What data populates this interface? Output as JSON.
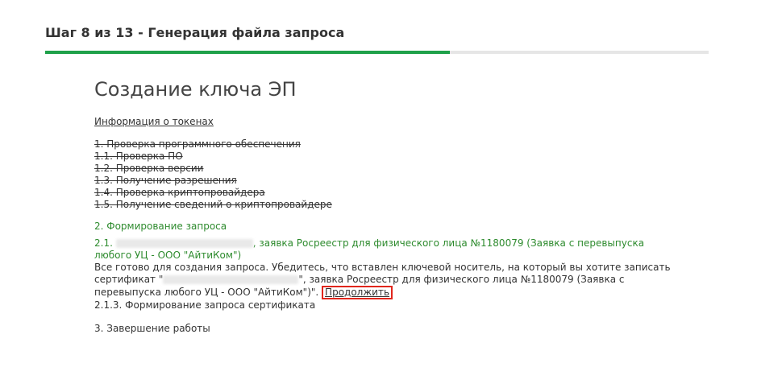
{
  "header": {
    "step_title": "Шаг 8 из 13 - Генерация файла запроса",
    "progress_fraction": 0.61
  },
  "main": {
    "title": "Создание ключа ЭП",
    "token_info_link": "Информация о токенах",
    "section1": {
      "items": [
        "1. Проверка программного обеспечения",
        "1.1. Проверка ПО",
        "1.2. Проверка версии",
        "1.3. Получение разрешения",
        "1.4. Проверка криптопровайдера",
        "1.5. Получение сведений о криптопровайдере"
      ]
    },
    "section2": {
      "title": "2. Формирование запроса",
      "item_number": "2.1.",
      "item_text": ", заявка Росреестр для физического лица №1180079 (Заявка с перевыпуска любого УЦ - ООО \"АйтиКом\")",
      "detail_before": "Все готово для создания запроса. Убедитесь, что вставлен ключевой носитель, на который вы хотите записать сертификат \"",
      "detail_after": "\", заявка Росреестр для физического лица №1180079 (Заявка с перевыпуска любого УЦ - ООО \"АйтиКом\")\".",
      "continue_link": "Продолжить",
      "subitem": "2.1.3. Формирование запроса сертификата"
    },
    "section3": {
      "title": "3. Завершение работы"
    },
    "colors": {
      "accent_green": "#2e8b2e",
      "progress_green": "#1fa14a",
      "highlight_red": "#e1261c"
    }
  }
}
